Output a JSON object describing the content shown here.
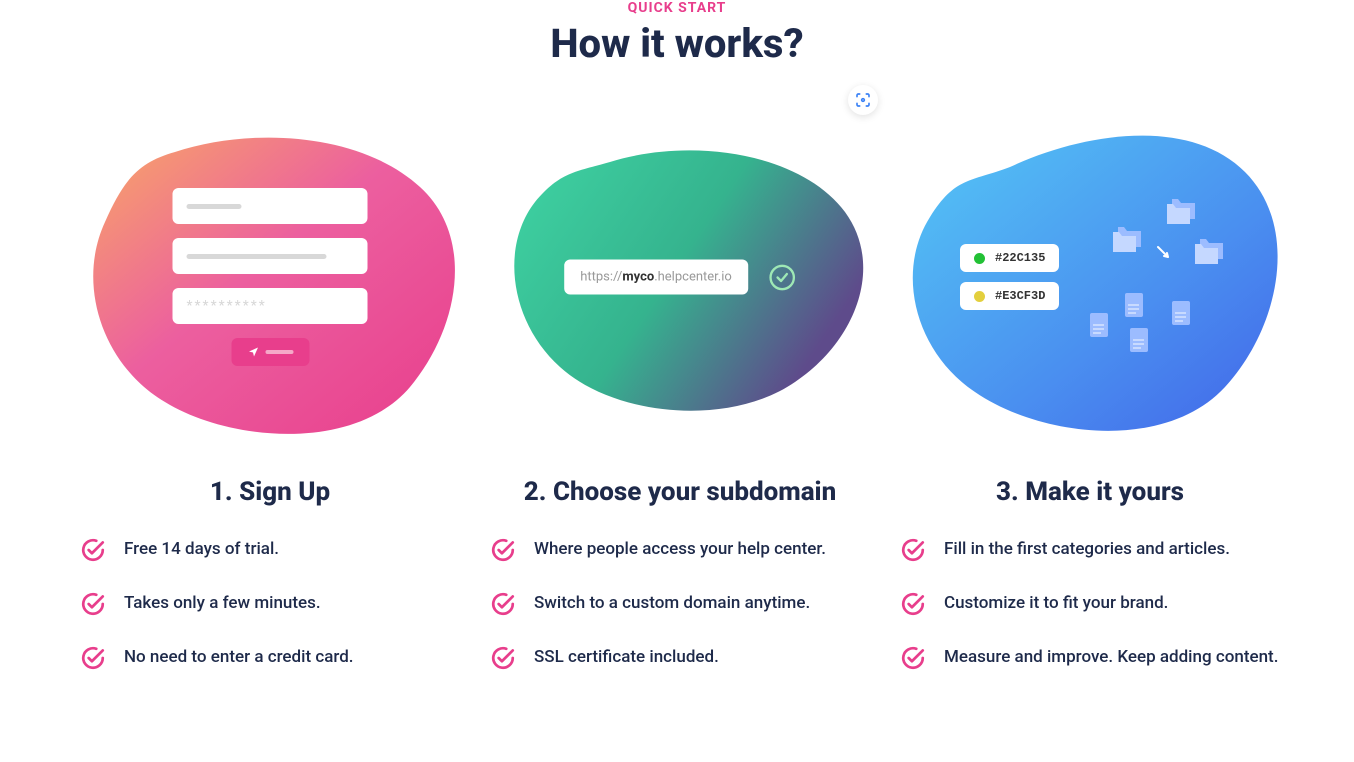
{
  "header": {
    "eyebrow": "QUICK START",
    "title": "How it works?"
  },
  "steps": [
    {
      "title": "1. Sign Up",
      "bullets": [
        "Free 14 days of trial.",
        "Takes only a few minutes.",
        "No need to enter a credit card."
      ]
    },
    {
      "title": "2. Choose your subdomain",
      "bullets": [
        "Where people access your help center.",
        "Switch to a custom domain anytime.",
        "SSL certificate included."
      ],
      "domain": {
        "prefix": "https://",
        "bold": "myco",
        "suffix": ".helpcenter.io"
      }
    },
    {
      "title": "3. Make it yours",
      "bullets": [
        "Fill in the first categories and articles.",
        "Customize it to fit your brand.",
        "Measure and improve. Keep adding content."
      ],
      "colors": [
        {
          "swatch": "#22C135",
          "label": "#22C135"
        },
        {
          "swatch": "#E3CF3D",
          "label": "#E3CF3D"
        }
      ]
    }
  ]
}
